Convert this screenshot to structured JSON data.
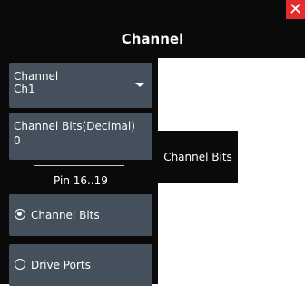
{
  "header": {
    "title": "Channel",
    "close_label": "✕"
  },
  "sidebar": {
    "channel_dropdown": {
      "label": "Channel",
      "value": "Ch1"
    },
    "channel_bits": {
      "label": "Channel Bits(Decimal)",
      "value": "0"
    },
    "pin_label": "Pin 16..19",
    "radios": [
      {
        "label": "Channel Bits",
        "selected": true
      },
      {
        "label": "Drive Ports",
        "selected": false
      }
    ]
  },
  "tab": {
    "label": "Channel Bits"
  },
  "colors": {
    "background": "#0a0a0a",
    "button": "#44505c",
    "close": "#e52b2b"
  }
}
